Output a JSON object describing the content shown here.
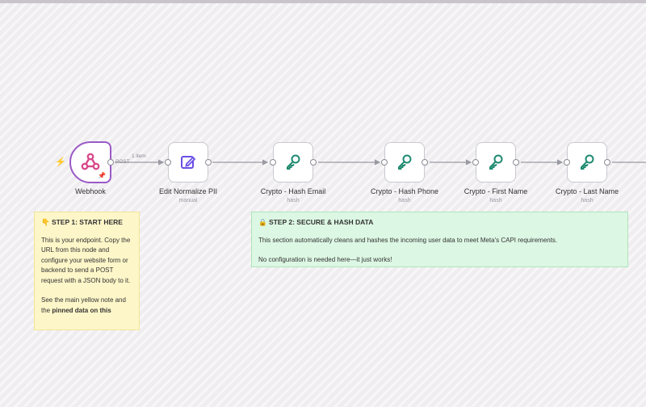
{
  "nodes": [
    {
      "label": "Webhook",
      "sub": "",
      "icon": "webhook-icon"
    },
    {
      "label": "Edit Normalize PII",
      "sub": "manual",
      "icon": "edit-icon"
    },
    {
      "label": "Crypto - Hash Email",
      "sub": "hash",
      "icon": "key-icon"
    },
    {
      "label": "Crypto - Hash Phone",
      "sub": "hash",
      "icon": "key-icon"
    },
    {
      "label": "Crypto - First Name",
      "sub": "hash",
      "icon": "key-icon"
    },
    {
      "label": "Crypto - Last Name",
      "sub": "hash",
      "icon": "key-icon"
    }
  ],
  "edge_labels": {
    "items": "1 item",
    "method": "POST"
  },
  "notes": {
    "step1": {
      "title": "👇 STEP 1: START HERE",
      "p1": "This is your endpoint. Copy the URL from this node and configure your website form or backend to send a POST request with a JSON body to it.",
      "p2_prefix": "See the main yellow note and the ",
      "p2_bold": "pinned data on this"
    },
    "step2": {
      "title": "🔒 STEP 2: SECURE & HASH DATA",
      "p1": "This section automatically cleans and hashes the incoming user data to meet Meta's CAPI requirements.",
      "p2": "No configuration is needed here—it just works!"
    }
  },
  "colors": {
    "trigger_border": "#9b59c7",
    "webhook_icon": "#d94a8c",
    "edit_icon": "#6b4ee6",
    "key_icon": "#1f8a70",
    "bolt": "#f39c12",
    "note_yellow": "#fdf6c8",
    "note_green": "#dcf7e3"
  }
}
